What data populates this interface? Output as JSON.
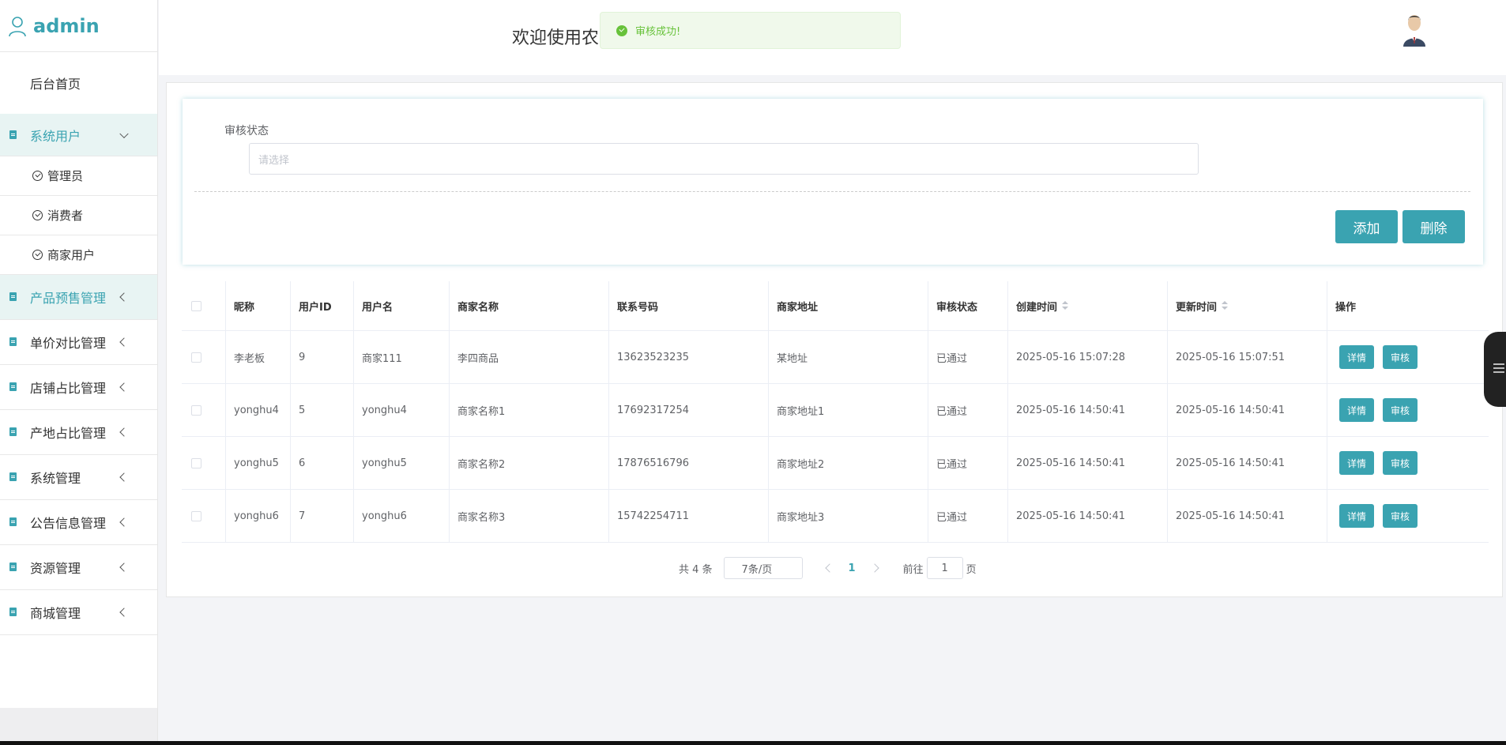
{
  "brand": {
    "title": "admin"
  },
  "header": {
    "welcome": "欢迎使用农"
  },
  "toast": {
    "message": "审核成功!"
  },
  "sidebar": {
    "home": "后台首页",
    "group_open": "系统用户",
    "sub_items": [
      "管理员",
      "消费者",
      "商家用户"
    ],
    "groups": [
      "产品预售管理",
      "单价对比管理",
      "店铺占比管理",
      "产地占比管理",
      "系统管理",
      "公告信息管理",
      "资源管理",
      "商城管理"
    ]
  },
  "search": {
    "label": "审核状态",
    "placeholder": "请选择"
  },
  "actions": {
    "add": "添加",
    "delete": "删除"
  },
  "table": {
    "headers": [
      "昵称",
      "用户ID",
      "用户名",
      "商家名称",
      "联系号码",
      "商家地址",
      "审核状态",
      "创建时间",
      "更新时间",
      "操作"
    ],
    "rows": [
      [
        "李老板",
        "9",
        "商家111",
        "李四商品",
        "13623523235",
        "某地址",
        "已通过",
        "2025-05-16 15:07:28",
        "2025-05-16 15:07:51"
      ],
      [
        "yonghu4",
        "5",
        "yonghu4",
        "商家名称1",
        "17692317254",
        "商家地址1",
        "已通过",
        "2025-05-16 14:50:41",
        "2025-05-16 14:50:41"
      ],
      [
        "yonghu5",
        "6",
        "yonghu5",
        "商家名称2",
        "17876516796",
        "商家地址2",
        "已通过",
        "2025-05-16 14:50:41",
        "2025-05-16 14:50:41"
      ],
      [
        "yonghu6",
        "7",
        "yonghu6",
        "商家名称3",
        "15742254711",
        "商家地址3",
        "已通过",
        "2025-05-16 14:50:41",
        "2025-05-16 14:50:41"
      ]
    ],
    "row_buttons": {
      "detail": "详情",
      "audit": "审核"
    }
  },
  "pager": {
    "total": "共 4 条",
    "page_size": "7条/页",
    "current": "1",
    "goto_prefix": "前往",
    "goto_value": "1",
    "goto_suffix": "页"
  },
  "colors": {
    "accent": "#3aa3b1",
    "success": "#67c23a"
  }
}
